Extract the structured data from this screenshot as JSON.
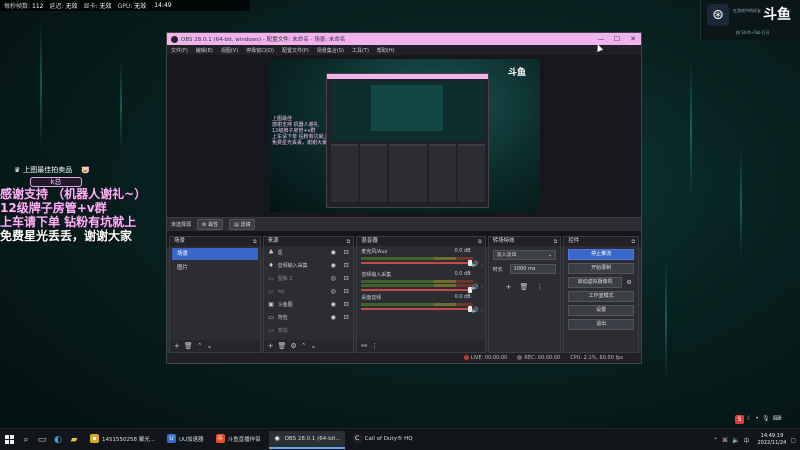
{
  "stats": {
    "fps_label": "每秒帧数:",
    "fps_value": "112",
    "latency_label": "延迟:",
    "latency_value": "无效",
    "video_card_label": "显卡:",
    "video_card_value": "无效",
    "gpu_label": "GPU:",
    "gpu_value": "无效",
    "time": "14:49"
  },
  "overlay": {
    "fans_text": "上图最佳拍卖品",
    "badge": "k总",
    "lines": [
      "感谢支持 （机器人谢礼~）",
      "12级牌子房管+v群",
      "上车请下单 钻粉有坑就上",
      "免费星光丢丢，谢谢大家"
    ]
  },
  "top_right": {
    "steam_label": "在游戏中的好友",
    "logo": "斗鱼",
    "hint": "按 Shift+Tab 打开"
  },
  "obs": {
    "title": "OBS 28.0.1 (64-bit, windows) - 配置文件: 未命名 - 场景: 未命名",
    "window_controls": [
      "—",
      "☐",
      "✕"
    ],
    "menu": [
      "文件(F)",
      "编辑(E)",
      "视图(V)",
      "停靠窗口(D)",
      "配置文件(P)",
      "场景集合(S)",
      "工具(T)",
      "帮助(H)"
    ],
    "preview_logo": "斗鱼",
    "preview_lines": [
      "上图最佳",
      "感谢支持 机器人谢礼",
      "12级牌子房管+v群",
      "上车请下单 钻粉有坑就上",
      "免费星光丢丢，谢谢大家"
    ],
    "source_bar": {
      "label": "未选择源",
      "properties": "属性",
      "filters": "滤镜"
    },
    "scenes": {
      "title": "场景",
      "items": [
        "场景",
        "图片"
      ]
    },
    "sources": {
      "title": "来源",
      "items": [
        {
          "icon": "♣",
          "name": "星"
        },
        {
          "icon": "♦",
          "name": "音频输入采集"
        },
        {
          "icon": "▭",
          "name": "图像 2"
        },
        {
          "icon": "▭",
          "name": "mj"
        },
        {
          "icon": "▣",
          "name": "斗鱼图"
        },
        {
          "icon": "▭",
          "name": "背包"
        },
        {
          "icon": "▭",
          "name": "发钻"
        }
      ]
    },
    "mixer": {
      "title": "混音器",
      "channels": [
        {
          "name": "麦克风/Aux",
          "db": "0.0 dB"
        },
        {
          "name": "音频输入采集",
          "db": "0.0 dB"
        },
        {
          "name": "桌面音频",
          "db": "0.0 dB"
        }
      ]
    },
    "transitions": {
      "title": "转场特效",
      "selected": "淡入淡出",
      "duration_label": "时长",
      "duration_value": "1000 ms"
    },
    "controls": {
      "title": "控件",
      "stop_stream": "停止推流",
      "start_record": "开始录制",
      "virtual_camera": "启动虚拟摄像机",
      "studio_mode": "工作室模式",
      "settings": "设置",
      "exit": "退出"
    },
    "status": {
      "live": "LIVE: 00:00:00",
      "rec": "REC: 00:00:00",
      "cpu": "CPU: 2.1%, 60.00 fps"
    }
  },
  "taskbar": {
    "tasks": [
      {
        "label": "1451550258 聚光...",
        "color": "#d9a82b"
      },
      {
        "label": "UU加速器",
        "color": "#2f6fd1"
      },
      {
        "label": "斗鱼直播伴侣",
        "color": "#e24d2b"
      },
      {
        "label": "OBS 28.0.1 (64-bit...",
        "color": "#333333"
      },
      {
        "label": "Call of Duty® HQ",
        "color": "#222222"
      }
    ],
    "clock_time": "14:49:19",
    "clock_date": "2022/11/24"
  }
}
